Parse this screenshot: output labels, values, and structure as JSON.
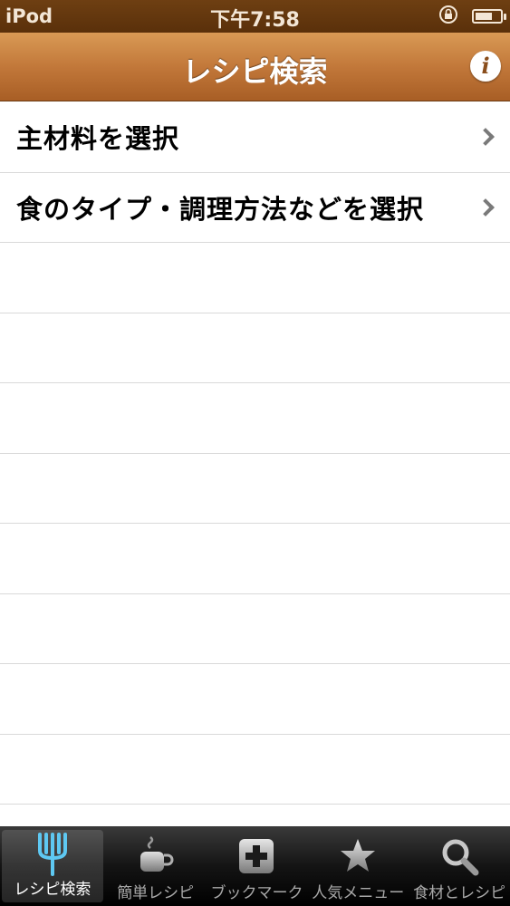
{
  "status_bar": {
    "carrier": "iPod",
    "time": "下午7:58"
  },
  "nav_bar": {
    "title": "レシピ検索",
    "info_label": "i"
  },
  "list": {
    "items": [
      {
        "label": "主材料を選択"
      },
      {
        "label": "食のタイプ・調理方法などを選択"
      }
    ]
  },
  "tab_bar": {
    "tabs": [
      {
        "label": "レシピ検索",
        "icon": "fork-icon",
        "active": true
      },
      {
        "label": "簡単レシピ",
        "icon": "coffee-cup-icon",
        "active": false
      },
      {
        "label": "ブックマーク",
        "icon": "plus-box-icon",
        "active": false
      },
      {
        "label": "人気メニュー",
        "icon": "star-icon",
        "active": false
      },
      {
        "label": "食材とレシピ",
        "icon": "search-icon",
        "active": false
      }
    ]
  },
  "colors": {
    "nav_gradient_top": "#d99a55",
    "nav_gradient_bottom": "#a85e25",
    "status_bar": "#5a300a",
    "active_tab_icon": "#5ec8f2"
  }
}
